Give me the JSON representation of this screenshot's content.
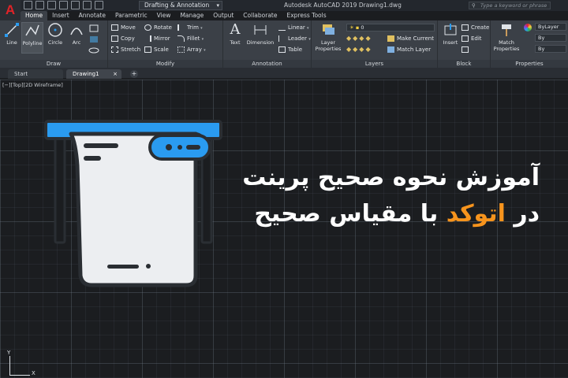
{
  "window": {
    "app_logo": "A",
    "workspace": "Drafting & Annotation",
    "title": "Autodesk AutoCAD 2019    Drawing1.dwg",
    "search_placeholder": "Type a keyword or phrase"
  },
  "ribbon_tabs": [
    "Home",
    "Insert",
    "Annotate",
    "Parametric",
    "View",
    "Manage",
    "Output",
    "Collaborate",
    "Express Tools"
  ],
  "draw": {
    "title": "Draw",
    "line": "Line",
    "polyline": "Polyline",
    "circle": "Circle",
    "arc": "Arc"
  },
  "modify": {
    "title": "Modify",
    "move": "Move",
    "rotate": "Rotate",
    "trim": "Trim",
    "copy": "Copy",
    "mirror": "Mirror",
    "fillet": "Fillet",
    "stretch": "Stretch",
    "scale": "Scale",
    "array": "Array"
  },
  "annotation": {
    "title": "Annotation",
    "text": "Text",
    "dimension": "Dimension",
    "linear": "Linear",
    "leader": "Leader",
    "table": "Table"
  },
  "layers": {
    "title": "Layers",
    "layer_properties": "Layer Properties",
    "current_layer": "0",
    "make_current": "Make Current",
    "match_layer": "Match Layer"
  },
  "block": {
    "title": "Block",
    "insert": "Insert",
    "create": "Create",
    "edit": "Edit"
  },
  "properties": {
    "title": "Properties",
    "match_properties": "Match Properties",
    "bylayer_1": "ByLayer",
    "bylayer_2": "By",
    "bylayer_3": "By"
  },
  "file_tabs": {
    "start": "Start",
    "drawing": "Drawing1"
  },
  "viewport_label": "[−][Top][2D Wireframe]",
  "headline": {
    "line1": "آموزش نحوه صحیح پرینت",
    "line2_prefix": "در ",
    "line2_accent": "اتوکد",
    "line2_suffix": " با مقیاس صحیح"
  },
  "ucs": {
    "y": "Y",
    "x": "X"
  },
  "colors": {
    "accent_orange": "#f7941d",
    "printer_blue": "#2a9bf0",
    "canvas_bg": "#1b1d20",
    "logo_red": "#e02328"
  }
}
